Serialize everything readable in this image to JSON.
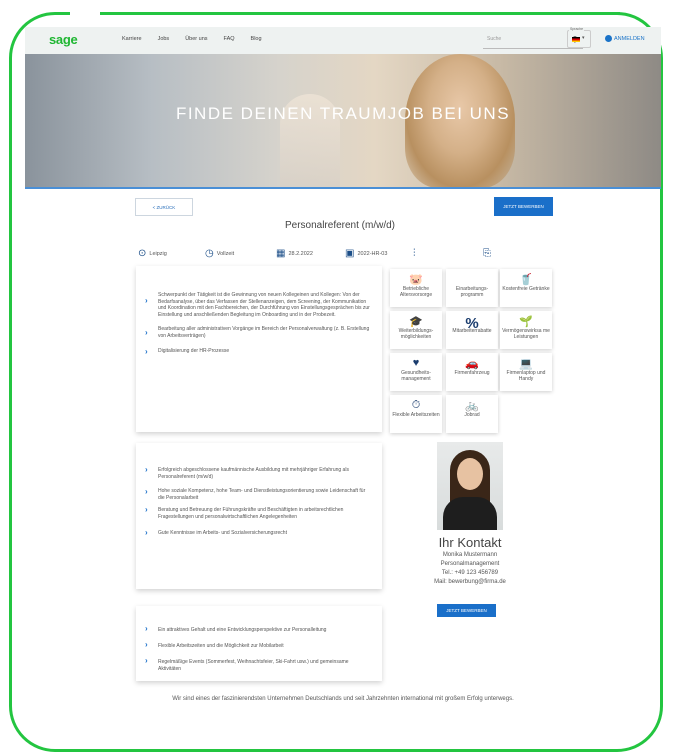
{
  "nav": {
    "logo": "sage",
    "items": [
      "Karriere",
      "Jobs",
      "Über uns",
      "FAQ",
      "Blog"
    ],
    "search_placeholder": "Suche",
    "language_label": "Sprache",
    "login": "ANMELDEN"
  },
  "hero": {
    "title": "FINDE DEINEN TRAUMJOB BEI UNS"
  },
  "actions": {
    "back": "< ZURÜCK",
    "apply": "JETZT BEWERBEN"
  },
  "job": {
    "title": "Personalreferent (m/w/d)",
    "location": "Leipzig",
    "type": "Vollzeit",
    "date": "28.2.2022",
    "id": "2022-HR-03"
  },
  "tasks": [
    "Schwerpunkt der Tätigkeit ist die Gewinnung von neuen Kollegeinen und Kollegen: Von der Bedarfsanalyse, über das Verfassen der Stellenanzeigen, dem Screening, der Kommunikation und Koordination mit den Fachbereichen, der Durchführung von Einstellungsgesprächen bis zur Einstellung und anschließenden Begleitung im Onboarding und in der Probezeit.",
    "Bearbeitung aller administrativen Vorgänge im Bereich der Personalverwaltung (z. B. Erstellung von Arbeitsverträgen)",
    "Digitalisierung der HR-Prozesse"
  ],
  "requirements": [
    "Erfolgreich abgeschlossene kaufmännische Ausbildung mit mehrjähriger Erfahrung als Personalreferent (m/w/d)",
    "Hohe soziale Kompetenz, hohe Team- und Dienstleistungsorientierung sowie Leidenschaft für die Personalarbeit",
    "Beratung und Betreuung der Führungskräfte und Beschäftigten in arbeitsrechtlichen Fragestellungen und personalwirtschaftlichen Angelegenheiten",
    "Gute Kenntnisse im Arbeits- und Sozialversicherungsrecht"
  ],
  "offers": [
    "Ein attraktives Gehalt und eine Entwicklungsperspektive zur Personalleitung",
    "Flexible Arbeitszeiten und die Möglichkeit zur Mobilarbeit",
    "Regelmäßige Events (Sommerfest, Weihnachtsfeier, Ski-Fahrt usw.) und gemeinsame Aktivitäten"
  ],
  "benefits": [
    {
      "icon": "piggy-bank-icon",
      "glyph": "🐷",
      "label": "Betriebliche Altersvorsorge"
    },
    {
      "icon": "referral-icon",
      "glyph": "",
      "label": "Einarbeitungs-programm"
    },
    {
      "icon": "drinks-icon",
      "glyph": "🥤",
      "label": "Kostenfreie Getränke"
    },
    {
      "icon": "training-icon",
      "glyph": "🎓",
      "label": "Weiterbildungs-möglichkeiten"
    },
    {
      "icon": "percent-icon",
      "glyph": "%",
      "label": "Mitarbeiterrabatte"
    },
    {
      "icon": "savings-plant-icon",
      "glyph": "🌱",
      "label": "Vermögenswirksa me Leistungen"
    },
    {
      "icon": "health-icon",
      "glyph": "♥",
      "label": "Gesundheits-management"
    },
    {
      "icon": "car-icon",
      "glyph": "🚗",
      "label": "Firmenfahrzeug"
    },
    {
      "icon": "laptop-icon",
      "glyph": "💻",
      "label": "Firmenlaptop und Handy"
    },
    {
      "icon": "flexible-time-icon",
      "glyph": "⏱",
      "label": "Flexible Arbeitszeiten"
    },
    {
      "icon": "bike-icon",
      "glyph": "🚲",
      "label": "Jobrad"
    }
  ],
  "contact": {
    "heading": "Ihr Kontakt",
    "name": "Monika Mustermann",
    "department": "Personalmanagement",
    "phone": "Tel.: +49 123 456789",
    "mail": "Mail: bewerbung@firma.de"
  },
  "footer": "Wir sind eines der faszinierendsten Unternehmen Deutschlands und seit Jahrzehnten international mit großem Erfolg unterwegs.",
  "colors": {
    "accent": "#1a6fc9",
    "frame": "#23c540",
    "logo": "#1fb632"
  }
}
